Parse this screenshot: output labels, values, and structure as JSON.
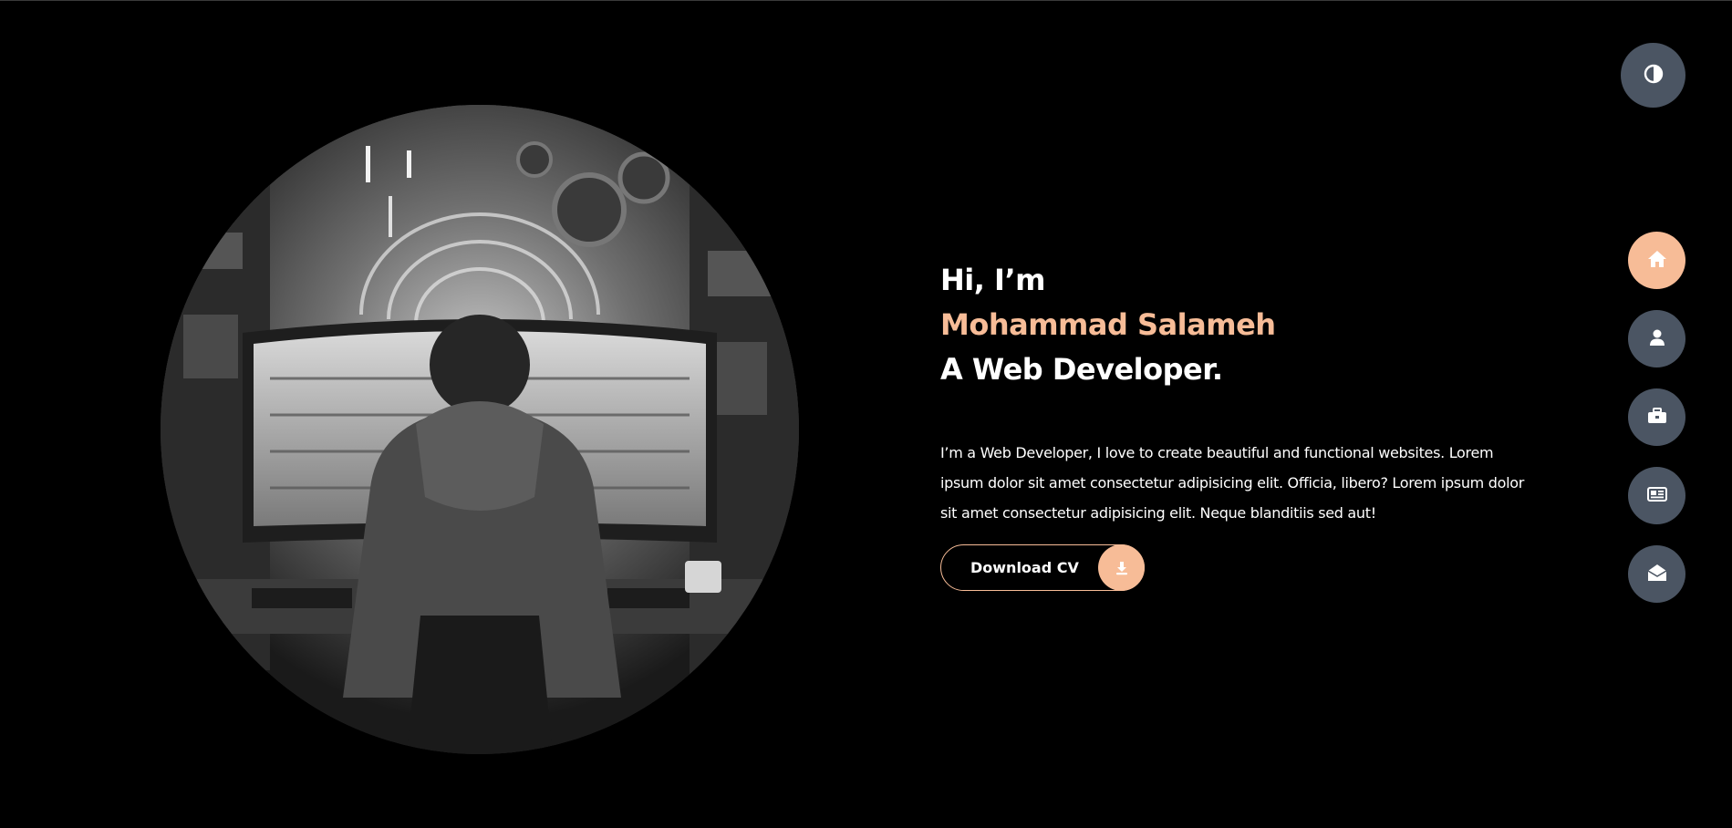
{
  "hero": {
    "greeting": "Hi, I’m",
    "name": "Mohammad Salameh",
    "role": "A Web Developer.",
    "description": "I’m a Web Developer, I love to create beautiful and functional websites. Lorem ipsum dolor sit amet consectetur adipisicing elit. Officia, libero? Lorem ipsum dolor sit amet consectetur adipisicing elit. Neque blanditiis sed aut!",
    "cv_button_label": "Download CV",
    "cv_icon": "download-icon"
  },
  "theme_toggle": {
    "icon": "contrast-icon"
  },
  "nav": {
    "items": [
      {
        "id": "home",
        "icon": "home-icon",
        "active": true
      },
      {
        "id": "about",
        "icon": "user-icon",
        "active": false
      },
      {
        "id": "portfolio",
        "icon": "briefcase-icon",
        "active": false
      },
      {
        "id": "blog",
        "icon": "newspaper-icon",
        "active": false
      },
      {
        "id": "contact",
        "icon": "envelope-open-icon",
        "active": false
      }
    ]
  },
  "colors": {
    "background": "#000000",
    "accent": "#f7bc97",
    "rail_button": "#4b5563",
    "text": "#ffffff"
  }
}
